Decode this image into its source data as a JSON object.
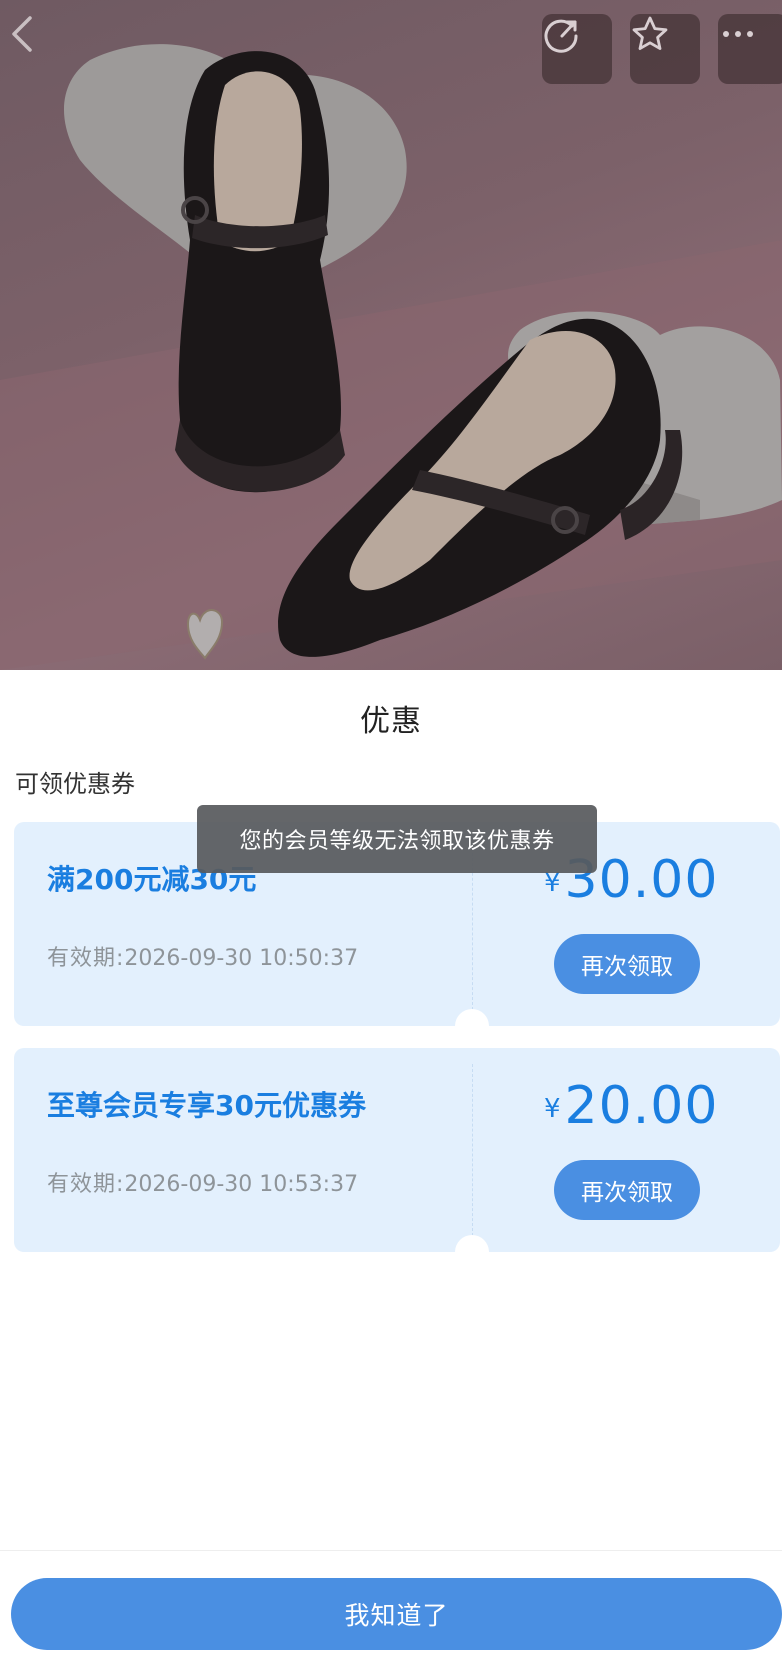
{
  "header": {
    "back_icon": "chevron-left-icon",
    "actions": [
      {
        "name": "share",
        "icon": "share-icon"
      },
      {
        "name": "favorite",
        "icon": "star-icon"
      },
      {
        "name": "more",
        "icon": "more-icon"
      }
    ]
  },
  "sheet": {
    "title": "优惠",
    "section_label": "可领优惠券",
    "coupons": [
      {
        "name": "满200元减30元",
        "validity_label": "有效期:",
        "validity_value": "2026-09-30 10:50:37",
        "currency": "¥",
        "amount": "30.00",
        "button_label": "再次领取"
      },
      {
        "name": "至尊会员专享30元优惠券",
        "validity_label": "有效期:",
        "validity_value": "2026-09-30 10:53:37",
        "currency": "¥",
        "amount": "20.00",
        "button_label": "再次领取"
      }
    ],
    "confirm_label": "我知道了"
  },
  "toast": {
    "message": "您的会员等级无法领取该优惠券"
  },
  "colors": {
    "accent": "#4a8fe2",
    "coupon_text": "#1a7ee0",
    "coupon_bg": "#e3f0fd"
  }
}
